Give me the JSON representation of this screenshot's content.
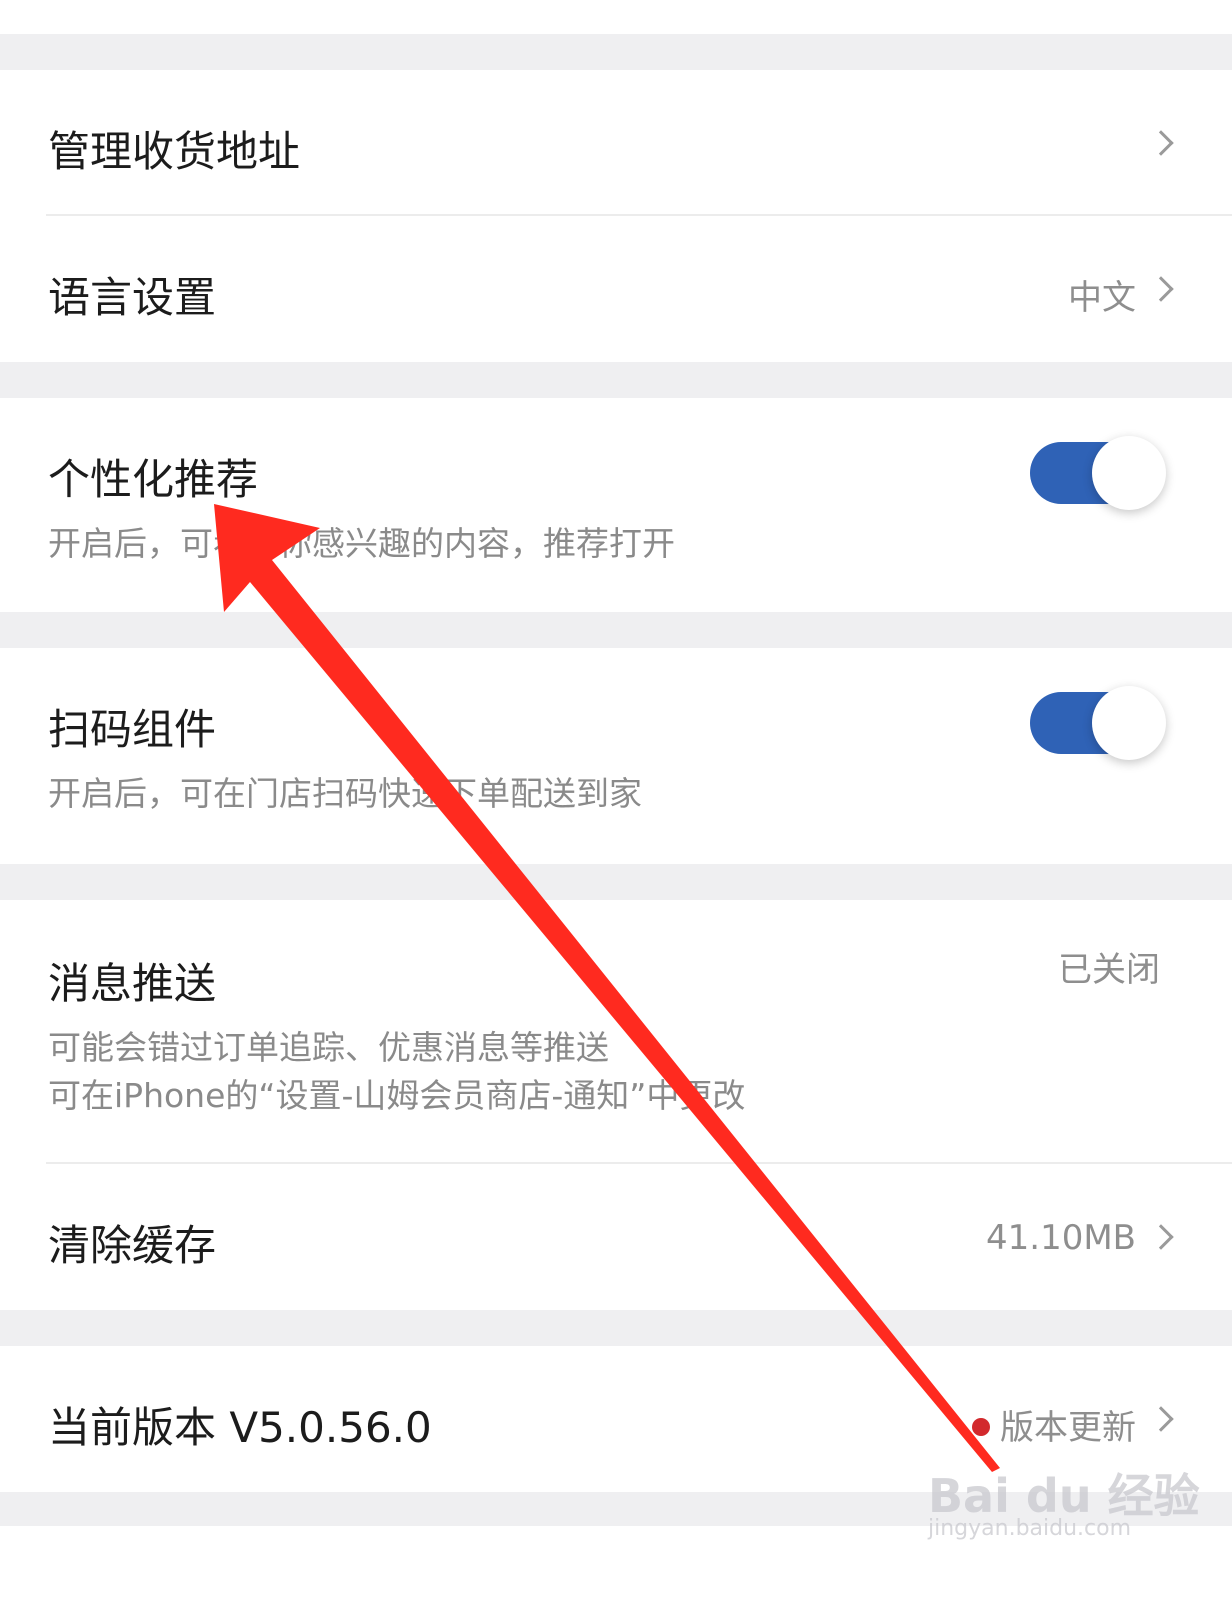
{
  "settings": {
    "address": {
      "title": "管理收货地址"
    },
    "language": {
      "title": "语言设置",
      "value": "中文"
    },
    "personalized": {
      "title": "个性化推荐",
      "desc": "开启后，可看到你感兴趣的内容，推荐打开",
      "enabled": true
    },
    "scan_widget": {
      "title": "扫码组件",
      "desc": "开启后，可在门店扫码快速下单配送到家",
      "enabled": true
    },
    "push": {
      "title": "消息推送",
      "value": "已关闭",
      "desc_line1": "可能会错过订单追踪、优惠消息等推送",
      "desc_line2": "可在iPhone的“设置-山姆会员商店-通知”中更改"
    },
    "cache": {
      "title": "清除缓存",
      "value": "41.10MB"
    },
    "version": {
      "title": "当前版本 V5.0.56.0",
      "update_label": "版本更新"
    }
  },
  "colors": {
    "toggle_on": "#2f62b6",
    "update_dot": "#d2292d",
    "annotation_arrow": "#ff2a1f"
  },
  "icons": {
    "row_chevron": "chevron-right-icon",
    "annotation": "red-arrow-icon"
  },
  "watermark": {
    "brand": "Bai du 经验",
    "url": "jingyan.baidu.com"
  }
}
